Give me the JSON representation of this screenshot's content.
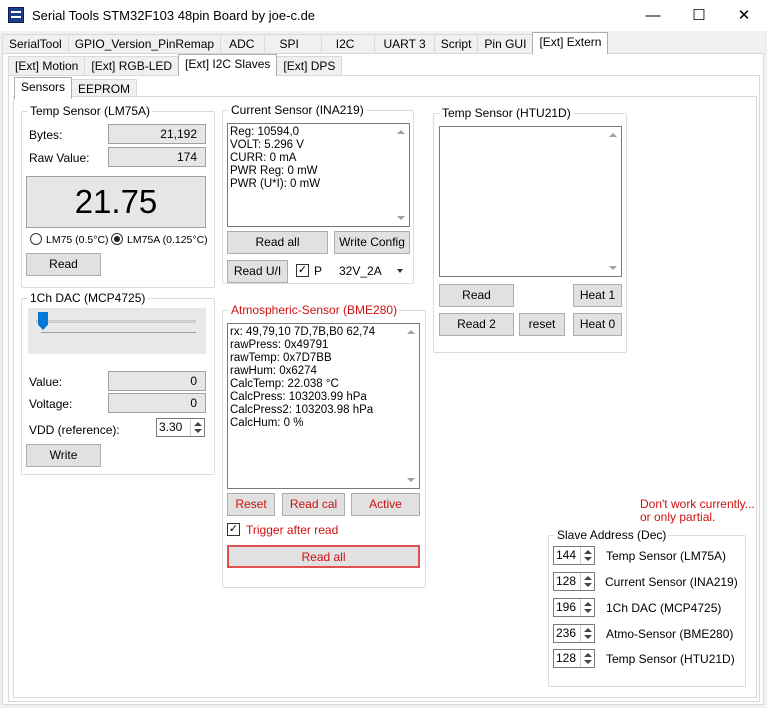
{
  "window": {
    "title": "Serial Tools STM32F103 48pin Board by joe-c.de",
    "minimize": "—",
    "maximize": "☐",
    "close": "✕"
  },
  "main_tabs": [
    "SerialTool",
    "GPIO_Version_PinRemap",
    "ADC",
    "SPI",
    "I2C",
    "UART 3",
    "Script",
    "Pin GUI",
    "[Ext] Extern"
  ],
  "ext_tabs": [
    "[Ext] Motion",
    "[Ext] RGB-LED",
    "[Ext] I2C Slaves",
    "[Ext] DPS"
  ],
  "inner_tabs": [
    "Sensors",
    "EEPROM"
  ],
  "lm75": {
    "title": "Temp Sensor (LM75A)",
    "bytes_label": "Bytes:",
    "bytes_value": "21,192",
    "raw_label": "Raw Value:",
    "raw_value": "174",
    "temperature": "21.75",
    "radio_lm75": "LM75 (0.5°C)",
    "radio_lm75a": "LM75A (0.125°C)",
    "read": "Read"
  },
  "dac": {
    "title": "1Ch DAC (MCP4725)",
    "value_label": "Value:",
    "value": "0",
    "voltage_label": "Voltage:",
    "voltage": "0",
    "vdd_label": "VDD (reference):",
    "vdd_value": "3.30",
    "write": "Write",
    "slider_level": 0
  },
  "ina219": {
    "title": "Current Sensor (INA219)",
    "lines": [
      "Reg: 10594,0",
      "VOLT: 5.296 V",
      "CURR: 0 mA",
      "PWR Reg: 0 mW",
      "PWR (U*I): 0 mW"
    ],
    "read_all": "Read all",
    "write_config": "Write Config",
    "read_ui": "Read U/I",
    "p_label": "P",
    "range": "32V_2A"
  },
  "bme280": {
    "title": "Atmospheric-Sensor (BME280)",
    "lines": [
      "rx: 49,79,10 7D,7B,B0 62,74",
      "rawPress: 0x49791",
      "rawTemp: 0x7D7BB",
      "rawHum: 0x6274",
      "CalcTemp: 22.038 °C",
      "CalcPress: 103203.99 hPa",
      "CalcPress2: 103203.98 hPa",
      "CalcHum: 0 %"
    ],
    "reset": "Reset",
    "read_cal": "Read cal",
    "active": "Active",
    "trigger": "Trigger after read",
    "read_all": "Read all"
  },
  "htu21d": {
    "title": "Temp Sensor (HTU21D)",
    "read": "Read",
    "heat1": "Heat 1",
    "read2": "Read 2",
    "reset": "reset",
    "heat0": "Heat 0"
  },
  "notice": {
    "line1": "Don't work currently...",
    "line2": "or only partial."
  },
  "slaves": {
    "title": "Slave Address (Dec)",
    "items": [
      {
        "addr": "144",
        "name": "Temp Sensor (LM75A)"
      },
      {
        "addr": "128",
        "name": "Current Sensor (INA219)"
      },
      {
        "addr": "196",
        "name": "1Ch DAC (MCP4725)"
      },
      {
        "addr": "236",
        "name": "Atmo-Sensor (BME280)"
      },
      {
        "addr": "128",
        "name": "Temp Sensor (HTU21D)"
      }
    ]
  },
  "colors": {
    "accent_red": "#d01010",
    "slider_thumb": "#0078d7"
  }
}
